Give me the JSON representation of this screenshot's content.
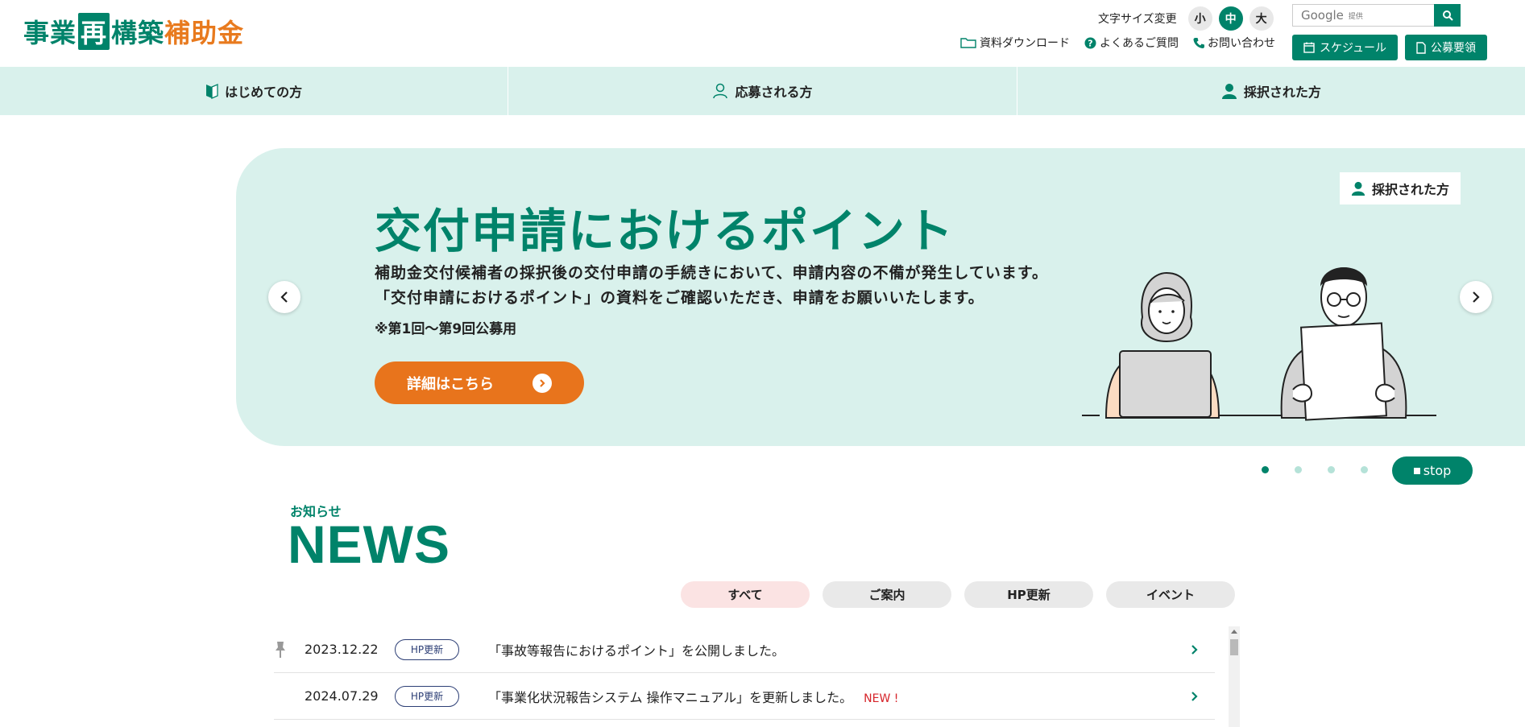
{
  "header": {
    "logo": {
      "part1": "事業",
      "part2": "再",
      "part3": "構築",
      "part4": "補助金"
    },
    "font_size": {
      "label": "文字サイズ変更",
      "small": "小",
      "medium": "中",
      "large": "大"
    },
    "search": {
      "placeholder": "Google",
      "powered": "提供"
    },
    "links": {
      "download": "資料ダウンロード",
      "faq": "よくあるご質問",
      "contact": "お問い合わせ"
    },
    "buttons": {
      "schedule": "スケジュール",
      "guidelines": "公募要領"
    }
  },
  "nav": {
    "items": [
      {
        "label": "はじめての方"
      },
      {
        "label": "応募される方"
      },
      {
        "label": "採択された方"
      }
    ]
  },
  "hero": {
    "title": "交付申請におけるポイント",
    "desc_line1": "補助金交付候補者の採択後の交付申請の手続きにおいて、申請内容の不備が発生しています。",
    "desc_line2": "「交付申請におけるポイント」の資料をご確認いただき、申請をお願いいたします。",
    "note": "※第1回〜第9回公募用",
    "cta": "詳細はこちら",
    "badge": "採択された方"
  },
  "carousel": {
    "stop": "stop",
    "current": 1,
    "total": 4
  },
  "news": {
    "subtitle": "お知らせ",
    "title": "NEWS",
    "filters": [
      "すべて",
      "ご案内",
      "HP更新",
      "イベント"
    ],
    "items": [
      {
        "date": "2023.12.22",
        "tag": "HP更新",
        "text": "「事故等報告におけるポイント」を公開しました。",
        "new": ""
      },
      {
        "date": "2024.07.29",
        "tag": "HP更新",
        "text": "「事業化状況報告システム 操作マニュアル」を更新しました。",
        "new": "NEW !"
      }
    ]
  },
  "colors": {
    "green": "#00836a",
    "orange": "#e8741c",
    "mint": "#d9f1ec",
    "red": "#d6242a"
  }
}
